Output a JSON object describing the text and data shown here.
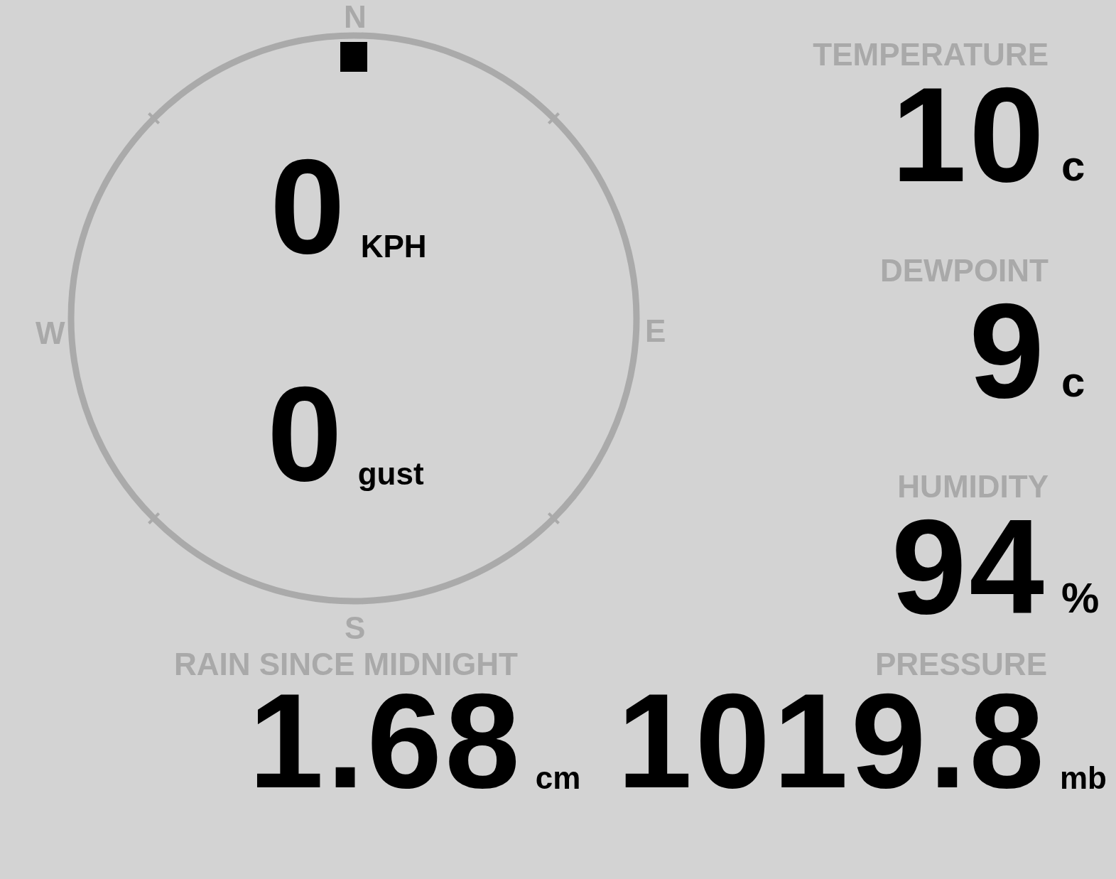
{
  "compass": {
    "north": "N",
    "east": "E",
    "south": "S",
    "west": "W"
  },
  "wind": {
    "speed": "0",
    "speed_unit": "KPH",
    "gust": "0",
    "gust_unit": "gust"
  },
  "readings": [
    {
      "label": "TEMPERATURE",
      "value": "10",
      "unit": "c"
    },
    {
      "label": "DEWPOINT",
      "value": "9",
      "unit": "c"
    },
    {
      "label": "HUMIDITY",
      "value": "94",
      "unit": "%"
    }
  ],
  "rain": {
    "label": "RAIN SINCE MIDNIGHT",
    "value": "1.68",
    "unit": "cm"
  },
  "pressure": {
    "label": "PRESSURE",
    "value": "1019.8",
    "unit": "mb"
  }
}
